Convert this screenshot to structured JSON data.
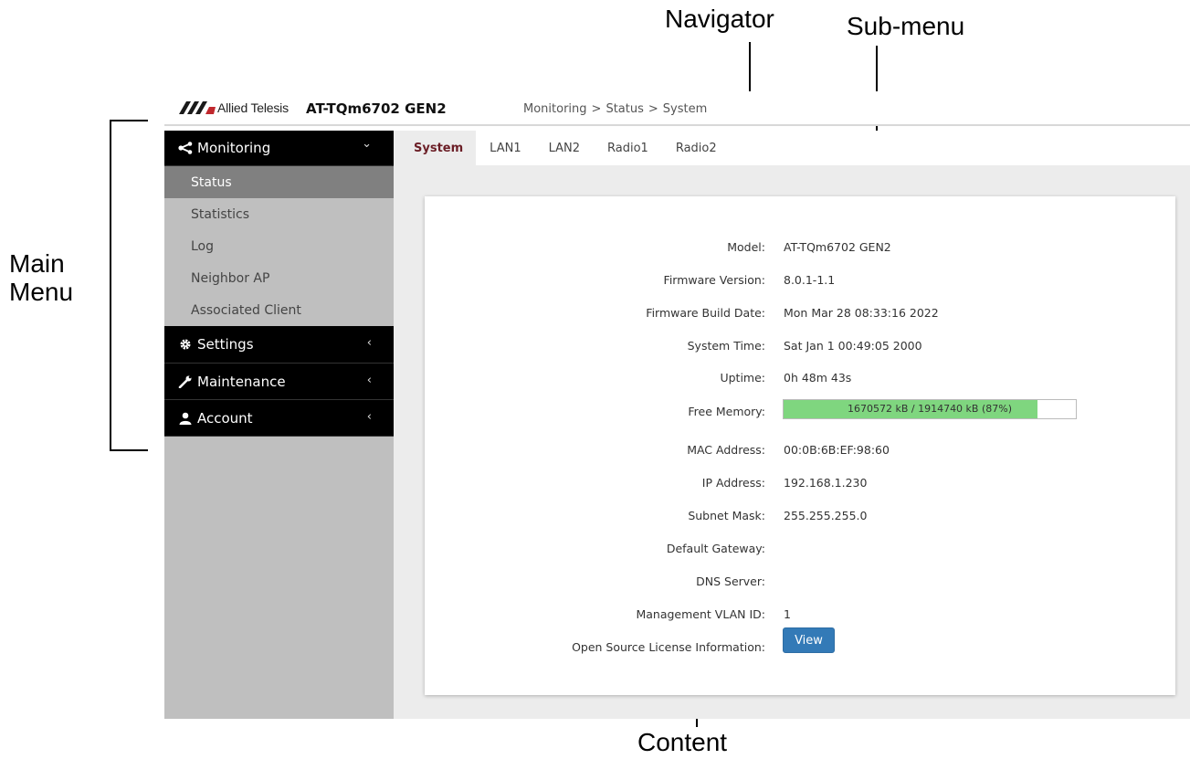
{
  "annotations": {
    "navigator": "Navigator",
    "submenu": "Sub-menu",
    "main_menu_line1": "Main",
    "main_menu_line2": "Menu",
    "content": "Content"
  },
  "header": {
    "brand": "Allied Telesis",
    "model": "AT-TQm6702 GEN2",
    "breadcrumb": [
      "Monitoring",
      "Status",
      "System"
    ],
    "separator": ">"
  },
  "sidebar": {
    "monitoring": {
      "label": "Monitoring",
      "icon": "share-icon",
      "arrow": "⌄"
    },
    "items": [
      "Status",
      "Statistics",
      "Log",
      "Neighbor AP",
      "Associated Client"
    ],
    "settings": {
      "label": "Settings",
      "icon": "gear-icon",
      "arrow": "‹"
    },
    "maintenance": {
      "label": "Maintenance",
      "icon": "wrench-icon",
      "arrow": "‹"
    },
    "account": {
      "label": "Account",
      "icon": "user-icon",
      "arrow": "‹"
    }
  },
  "tabs": [
    "System",
    "LAN1",
    "LAN2",
    "Radio1",
    "Radio2"
  ],
  "system": {
    "model": {
      "label": "Model:",
      "value": "AT-TQm6702 GEN2"
    },
    "firmware_version": {
      "label": "Firmware Version:",
      "value": "8.0.1-1.1"
    },
    "firmware_build_date": {
      "label": "Firmware Build Date:",
      "value": "Mon Mar 28 08:33:16 2022"
    },
    "system_time": {
      "label": "System Time:",
      "value": "Sat Jan 1 00:49:05 2000"
    },
    "uptime": {
      "label": "Uptime:",
      "value": "0h 48m 43s"
    },
    "free_memory": {
      "label": "Free Memory:",
      "value": "1670572 kB / 1914740 kB (87%)",
      "fraction": 0.87
    },
    "mac_address": {
      "label": "MAC Address:",
      "value": "00:0B:6B:EF:98:60"
    },
    "ip_address": {
      "label": "IP Address:",
      "value": "192.168.1.230"
    },
    "subnet_mask": {
      "label": "Subnet Mask:",
      "value": "255.255.255.0"
    },
    "default_gateway": {
      "label": "Default Gateway:",
      "value": ""
    },
    "dns_server": {
      "label": "DNS Server:",
      "value": ""
    },
    "mgmt_vlan": {
      "label": "Management VLAN ID:",
      "value": "1"
    },
    "license": {
      "label": "Open Source License Information:",
      "button": "View"
    }
  },
  "colors": {
    "accent_tab": "#6b1e26",
    "memory_fill": "#7fd67f",
    "button": "#337ab7",
    "menu_bg": "#000000",
    "sidebar_bg": "#bfbfbf"
  }
}
